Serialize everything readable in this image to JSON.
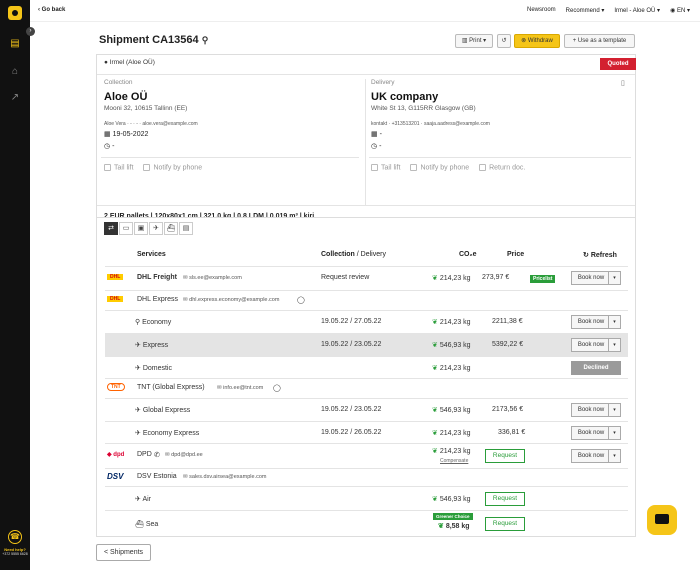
{
  "nav": {
    "go_back": "Go back",
    "newsroom": "Newsroom",
    "recommend": "Recommend ▾",
    "account": "Irmel - Aloe OÜ ▾",
    "language": "EN ▾",
    "help_title": "Need help?",
    "help_phone": "+372 5555 6628"
  },
  "shipment": {
    "title": "Shipment CA13564",
    "print": "Print ▾",
    "withdraw": "Withdraw",
    "use_template": "+ Use as a template",
    "sender": "Irmel (Aloe OÜ)",
    "status": "Quoted"
  },
  "collection": {
    "label": "Collection",
    "company": "Aloe OÜ",
    "address": "Mooni 32, 10615 Tallinn (EE)",
    "contact": "Aloe Vera  ·  -  ·  -  ·  aloe.vera@example.com",
    "date": "19-05-2022",
    "time": "-",
    "opt1": "Tail lift",
    "opt2": "Notify by phone"
  },
  "delivery": {
    "label": "Delivery",
    "company": "UK company",
    "address": "White St 13, G115RR Glasgow (GB)",
    "contact": "kontakt  ·  +313513201  ·  saaja.aadress@example.com",
    "date": "-",
    "time": "-",
    "opt1": "Tail lift",
    "opt2": "Notify by phone",
    "opt3": "Return doc."
  },
  "cargo": "2 EUR pallets  |  120x80x1 cm  |  321.0 kg  |  0.8 LDM  |  0.019 m³  |  kiri",
  "table": {
    "h_services": "Services",
    "h_collection": "Collection",
    "h_delivery": " / Delivery",
    "h_co2": "CO₂e",
    "h_price": "Price",
    "h_refresh": "Refresh",
    "book_now": "Book now",
    "declined": "Declined",
    "request": "Request",
    "pricelist": "Pricelist",
    "greener": "Greener Choice",
    "compensate": "Compensate",
    "rows": [
      {
        "carrier": "DHL Freight",
        "email": "sls.ee@example.com",
        "dates": "Request review",
        "co2": "214,23 kg",
        "price": "273,97 €"
      },
      {
        "carrier": "DHL Express",
        "email": "dhl.express.economy@example.com"
      },
      {
        "service": "Economy",
        "dates": "19.05.22 / 27.05.22",
        "co2": "214,23 kg",
        "price": "2211,38 €"
      },
      {
        "service": "Express",
        "dates": "19.05.22 / 23.05.22",
        "co2": "546,93 kg",
        "price": "5392,22 €"
      },
      {
        "service": "Domestic",
        "co2": "214,23 kg"
      },
      {
        "carrier": "TNT (Global Express)",
        "email": "info.ee@tnt.com"
      },
      {
        "service": "Global Express",
        "dates": "19.05.22 / 23.05.22",
        "co2": "546,93 kg",
        "price": "2173,56 €"
      },
      {
        "service": "Economy Express",
        "dates": "19.05.22 / 26.05.22",
        "co2": "214,23 kg",
        "price": "336,81 €"
      },
      {
        "carrier": "DPD",
        "email": "dpd@dpd.ee",
        "co2": "214,23 kg"
      },
      {
        "carrier": "DSV Estonia",
        "email": "sales.dsv.airsea@example.com"
      },
      {
        "service": "Air",
        "co2": "546,93 kg"
      },
      {
        "service": "Sea",
        "co2": "8,58 kg"
      }
    ]
  },
  "logos": {
    "dhl": "DHL",
    "tnt": "TNT",
    "dpd": "dpd",
    "dsv": "DSV"
  },
  "footer": {
    "shipments": "< Shipments"
  },
  "colors": {
    "accent": "#f5c518",
    "green": "#2a9d3a",
    "quoted": "#d32030"
  }
}
